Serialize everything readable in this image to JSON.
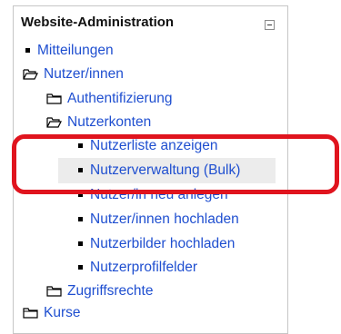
{
  "block": {
    "title": "Website-Administration",
    "collapse_icon": "minus-box-icon"
  },
  "nav": {
    "mitteilungen": "Mitteilungen",
    "nutzer_innen": "Nutzer/innen",
    "authentifizierung": "Authentifizierung",
    "nutzerkonten": "Nutzerkonten",
    "nutzerliste": "Nutzerliste anzeigen",
    "nutzerverwaltung_bulk": "Nutzerverwaltung (Bulk)",
    "nutzer_neu": "Nutzer/in neu anlegen",
    "nutzer_hochladen": "Nutzer/innen hochladen",
    "nutzerbilder": "Nutzerbilder hochladen",
    "nutzerprofilfelder": "Nutzerprofilfelder",
    "zugriffsrechte": "Zugriffsrechte",
    "kurse": "Kurse"
  },
  "colors": {
    "link": "#1f4fd0",
    "highlight_box": "#e0141e",
    "row_highlight": "#ececec"
  },
  "icons": {
    "bullet": "square-bullet-icon",
    "folder_open": "folder-open-icon",
    "folder_closed": "folder-closed-icon"
  }
}
